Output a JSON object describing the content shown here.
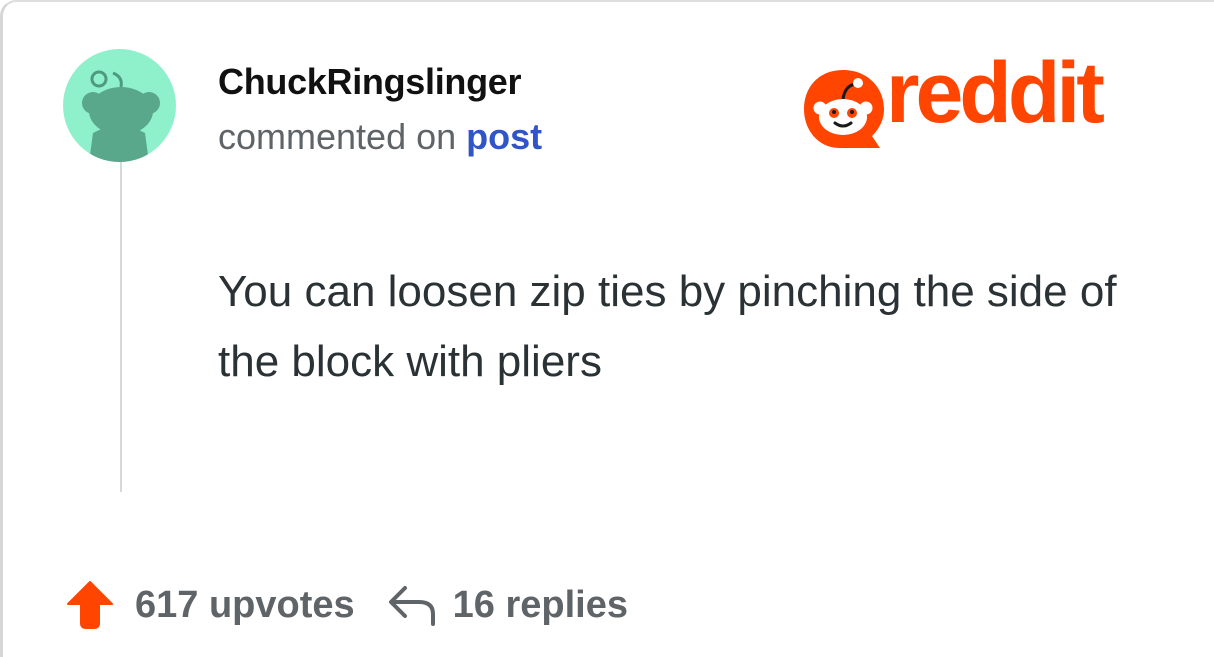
{
  "comment": {
    "username": "ChuckRingslinger",
    "action_text": "commented on",
    "post_link_text": "post",
    "body": "You can loosen zip ties by pinching the side of the block with pliers"
  },
  "brand": {
    "wordmark": "reddit",
    "color": "#ff4500"
  },
  "footer": {
    "upvotes_label": "617 upvotes",
    "replies_label": "16 replies"
  },
  "icons": {
    "avatar": "snoo-avatar-icon",
    "logo": "reddit-snoo-icon",
    "upvote": "upvote-arrow-icon",
    "reply": "reply-arrow-icon"
  },
  "colors": {
    "avatar_bg": "#8ff1cc",
    "avatar_figure": "#5aa88b",
    "link": "#2f55c8",
    "muted_text": "#5f6468",
    "body_text": "#2a3236"
  }
}
